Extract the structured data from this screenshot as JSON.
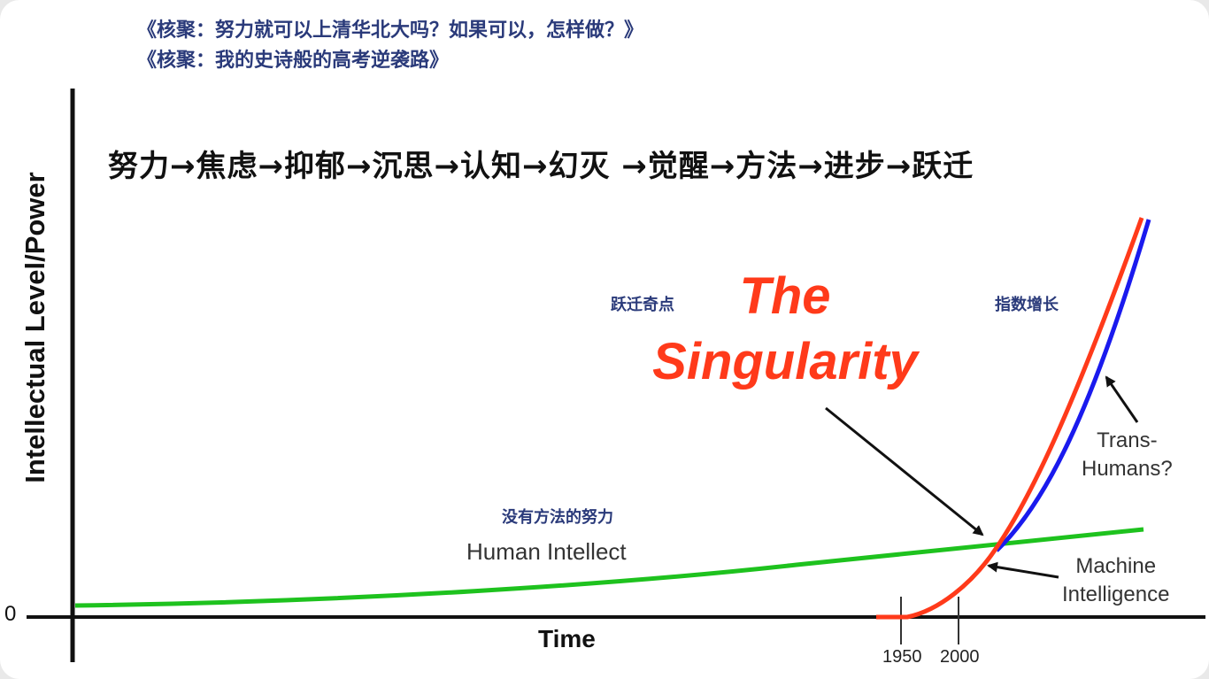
{
  "header": {
    "links": [
      "《核聚：努力就可以上清华北大吗？如果可以，怎样做？》",
      "《核聚：我的史诗般的高考逆袭路》"
    ]
  },
  "process_chain": "努力→焦虑→抑郁→沉思→认知→幻灭 →觉醒→方法→进步→跃迁",
  "axes": {
    "y_label": "Intellectual Level/Power",
    "x_label": "Time",
    "origin_label": "0",
    "ticks": [
      "1950",
      "2000"
    ]
  },
  "annotations": {
    "singularity_line1": "The",
    "singularity_line2": "Singularity",
    "leap_point": "跃迁奇点",
    "exponential_growth": "指数增长",
    "effort_without_method": "没有方法的努力",
    "human_intellect": "Human Intellect",
    "trans_humans_line1": "Trans-",
    "trans_humans_line2": "Humans?",
    "machine_line1": "Machine",
    "machine_line2": "Intelligence"
  },
  "colors": {
    "human_curve": "#1ec21e",
    "machine_curve": "#ff3a1a",
    "transhuman_curve": "#1a1aee",
    "singularity_text": "#ff3a1a",
    "note_text": "#2a3a7a"
  }
}
